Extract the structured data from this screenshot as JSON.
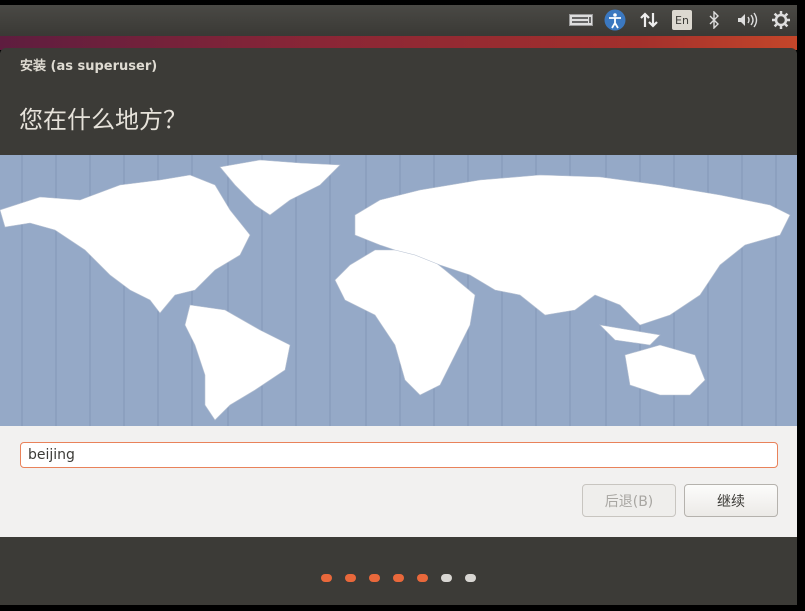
{
  "panel": {
    "indicators": [
      {
        "name": "keyboard-icon",
        "glyph": "⌨"
      },
      {
        "name": "accessibility-icon",
        "glyph": "♿"
      },
      {
        "name": "network-icon",
        "glyph": "⇅"
      },
      {
        "name": "language-indicator",
        "glyph": "En"
      },
      {
        "name": "bluetooth-icon",
        "glyph": "ᛒ"
      },
      {
        "name": "volume-icon",
        "glyph": "🔊"
      },
      {
        "name": "power-gear-icon",
        "glyph": "⚙"
      }
    ]
  },
  "window": {
    "title": "安装 (as superuser)",
    "question": "您在什么地方？"
  },
  "location": {
    "value": "beijing"
  },
  "buttons": {
    "back": "后退(B)",
    "continue": "继续"
  },
  "progress": {
    "total": 7,
    "completed": 5,
    "accent": "#e9683b",
    "inactive": "#d8d6d2"
  }
}
